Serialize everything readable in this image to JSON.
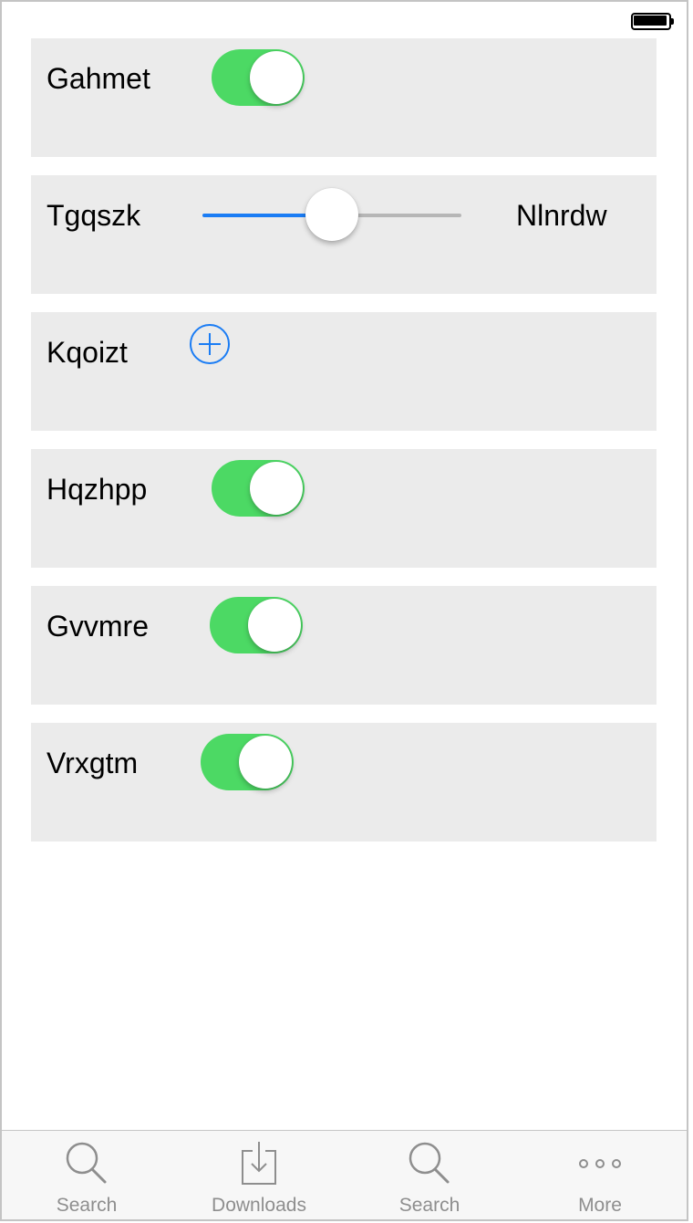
{
  "status_bar": {
    "battery_icon": "battery-full-icon"
  },
  "cells": [
    {
      "label": "Gahmet",
      "control": "toggle",
      "on": true
    },
    {
      "label": "Tgqszk",
      "control": "slider",
      "value_fraction": 0.5,
      "max_label": "Nlnrdw"
    },
    {
      "label": "Kqoizt",
      "control": "add-button",
      "icon": "plus-circle-icon"
    },
    {
      "label": "Hqzhpp",
      "control": "toggle",
      "on": true
    },
    {
      "label": "Gvvmre",
      "control": "toggle",
      "on": true
    },
    {
      "label": "Vrxgtm",
      "control": "toggle",
      "on": true
    }
  ],
  "tabbar": {
    "tabs": [
      {
        "label": "Search",
        "icon": "search-icon"
      },
      {
        "label": "Downloads",
        "icon": "download-icon"
      },
      {
        "label": "Search",
        "icon": "search-icon"
      },
      {
        "label": "More",
        "icon": "more-icon"
      }
    ]
  },
  "colors": {
    "toggle_on": "#4cd964",
    "accent": "#1a7cf4",
    "cell_bg": "#ebebeb",
    "tab_inactive": "#8e8e8e"
  }
}
